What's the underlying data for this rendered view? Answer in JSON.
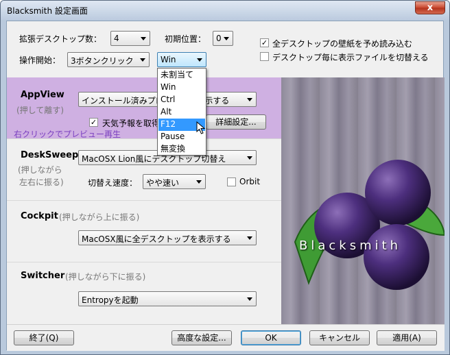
{
  "window": {
    "title": "Blacksmith 設定画面",
    "close_glyph": "x"
  },
  "top": {
    "desktops_label": "拡張デスクトップ数：",
    "desktops_value": "4",
    "initial_pos_label": "初期位置：",
    "initial_pos_value": "0",
    "operation_label": "操作開始：",
    "operation_value": "3ボタンクリック",
    "modifier_value": "Win",
    "preload_label": "全デスクトップの壁紙を予め読み込む",
    "preload_checked": "✓",
    "switch_files_label": "デスクトップ毎に表示ファイルを切替える"
  },
  "modifier_menu": {
    "items": [
      "未割当て",
      "Win",
      "Ctrl",
      "Alt",
      "F12",
      "Pause",
      "無変換"
    ],
    "selected_index": 4
  },
  "appview": {
    "title": "AppView",
    "hint": "(押して離す)",
    "combo_value": "インストール済みプログラムを表示する",
    "weather_label": "天気予報を取得",
    "weather_checked": "✓",
    "details_button": "詳細設定...",
    "preview_link": "右クリックでプレビュー再生"
  },
  "desksweep": {
    "title": "DeskSweep",
    "hint_line1": "(押しながら",
    "hint_line2": "左右に振る)",
    "combo_value": "MacOSX Lion風にデスクトップ切替え",
    "speed_label": "切替え速度：",
    "speed_value": "やや速い",
    "orbit_label": "Orbit"
  },
  "cockpit": {
    "title": "Cockpit",
    "hint": "(押しながら上に振る)",
    "combo_value": "MacOSX風に全デスクトップを表示する"
  },
  "switcher": {
    "title": "Switcher",
    "hint": "(押しながら下に振る)",
    "combo_value": "Entropyを起動"
  },
  "art": {
    "logo_text": "Blacksmith"
  },
  "buttons": {
    "quit": "終了(Q)",
    "advanced": "高度な設定...",
    "ok": "OK",
    "cancel": "キャンセル",
    "apply": "適用(A)"
  },
  "colors": {
    "appview_bg": "#cfb0e2",
    "selection": "#3399ff",
    "link": "#7a3fbf"
  }
}
